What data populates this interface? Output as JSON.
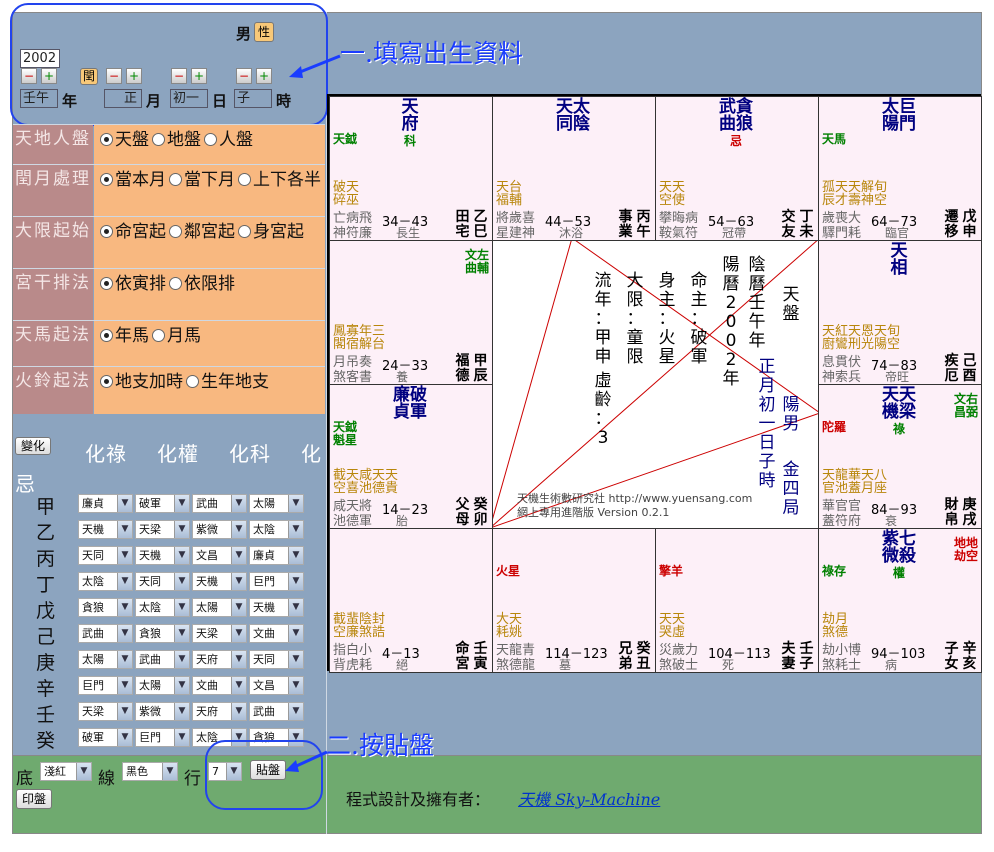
{
  "birth": {
    "gender_label": "男",
    "gender_button": "性",
    "year_input": "2002",
    "leap_button": "閏",
    "hour_box": "壬午",
    "year_label": "年",
    "month_box": "正",
    "month_label": "月",
    "day_box": "初一",
    "day_label": "日",
    "time_box": "子",
    "time_label": "時",
    "minus": "−",
    "plus": "+"
  },
  "annotations": {
    "step1": "一.填寫出生資料",
    "step2": "二.按貼盤"
  },
  "options": [
    {
      "label": "天地人盤",
      "choices": [
        "天盤",
        "地盤",
        "人盤"
      ],
      "selected": 0
    },
    {
      "label": "閏月處理",
      "choices": [
        "當本月",
        "當下月",
        "上下各半"
      ],
      "selected": 0
    },
    {
      "label": "大限起始",
      "choices": [
        "命宮起",
        "鄰宮起",
        "身宮起"
      ],
      "selected": 0
    },
    {
      "label": "宮干排法",
      "choices": [
        "依寅排",
        "依限排"
      ],
      "selected": 0
    },
    {
      "label": "天馬起法",
      "choices": [
        "年馬",
        "月馬"
      ],
      "selected": 0
    },
    {
      "label": "火鈴起法",
      "choices": [
        "地支加時",
        "生年地支"
      ],
      "selected": 0
    }
  ],
  "hua": {
    "button": "變化",
    "headers": [
      "化祿",
      "化權",
      "化科",
      "化忌"
    ],
    "rows": [
      {
        "stem": "甲",
        "v": [
          "廉貞",
          "破軍",
          "武曲",
          "太陽"
        ]
      },
      {
        "stem": "乙",
        "v": [
          "天機",
          "天梁",
          "紫微",
          "太陰"
        ]
      },
      {
        "stem": "丙",
        "v": [
          "天同",
          "天機",
          "文昌",
          "廉貞"
        ]
      },
      {
        "stem": "丁",
        "v": [
          "太陰",
          "天同",
          "天機",
          "巨門"
        ]
      },
      {
        "stem": "戊",
        "v": [
          "貪狼",
          "太陰",
          "太陽",
          "天機"
        ]
      },
      {
        "stem": "己",
        "v": [
          "武曲",
          "貪狼",
          "天梁",
          "文曲"
        ]
      },
      {
        "stem": "庚",
        "v": [
          "太陽",
          "武曲",
          "天府",
          "天同"
        ]
      },
      {
        "stem": "辛",
        "v": [
          "巨門",
          "太陽",
          "文曲",
          "文昌"
        ]
      },
      {
        "stem": "壬",
        "v": [
          "天梁",
          "紫微",
          "天府",
          "武曲"
        ]
      },
      {
        "stem": "癸",
        "v": [
          "破軍",
          "巨門",
          "太陰",
          "貪狼"
        ]
      }
    ]
  },
  "bottom": {
    "bg_label": "底",
    "bg_value": "淺紅",
    "line_label": "線",
    "line_value": "黑色",
    "row_label": "行",
    "row_value": "7",
    "paste_button": "貼盤",
    "print_button": "印盤",
    "credit_text": "程式設計及擁有者：",
    "credit_link": "天機 Sky-Machine"
  },
  "center": {
    "yin": "陰曆壬午年",
    "yang": "陽曆2002年",
    "month": "正月初一日子時",
    "pan": "天盤",
    "gender": "陽男",
    "ju": "金四局",
    "ming": "命主：破軍",
    "shen": "身主：火星",
    "daxian": "大限：童限",
    "liunian": "流年：甲申",
    "xusui": "虛齡：3",
    "footer1": "天機生術數研究社 http://www.yuensang.com",
    "footer2": "網上專用進階版 Version 0.2.1"
  },
  "palaces": [
    {
      "id": "si",
      "stars": [
        "天府"
      ],
      "mut": "科",
      "side_l": [
        "天鉞"
      ],
      "minor": [
        "破天",
        "碎巫"
      ],
      "line3": "亡病飛",
      "range": "34－43",
      "pal": "田宅",
      "stem": "乙巳",
      "line4": "神符廉",
      "life": "長生"
    },
    {
      "id": "wu",
      "stars": [
        "天同",
        "太陰"
      ],
      "mut": "",
      "side_l": [],
      "minor": [
        "天台",
        "福輔"
      ],
      "line3": "將歲喜",
      "range": "44－53",
      "pal": "事業",
      "stem": "丙午",
      "line4": "星建神",
      "life": "沐浴"
    },
    {
      "id": "wei",
      "stars": [
        "武曲",
        "貪狼"
      ],
      "mut": "忌",
      "side_l": [],
      "minor": [
        "天天",
        "空使"
      ],
      "line3": "攀晦病",
      "range": "54－63",
      "pal": "交友",
      "stem": "丁未",
      "line4": "鞍氣符",
      "life": "冠帶"
    },
    {
      "id": "shen",
      "stars": [
        "太陽",
        "巨門"
      ],
      "mut": "",
      "side_l": [
        "天馬"
      ],
      "minor": [
        "孤天天解旬",
        "辰才壽神空"
      ],
      "line3": "歲喪大",
      "range": "64－73",
      "pal": "遷移",
      "stem": "戊申",
      "line4": "驛門耗",
      "life": "臨官"
    },
    {
      "id": "chen",
      "stars": [],
      "mut": "",
      "side_r": [
        "文左",
        "曲輔"
      ],
      "minor": [
        "鳳寡年三",
        "閣宿解台"
      ],
      "line3": "月吊奏",
      "range": "24－33",
      "pal": "福德",
      "stem": "甲辰",
      "line4": "煞客書",
      "life": "養"
    },
    {
      "id": "you",
      "stars": [
        "天相"
      ],
      "mut": "",
      "minor": [
        "天紅天恩天旬",
        "廚鸞刑光陽空"
      ],
      "line3": "息貫伏",
      "range": "74－83",
      "pal": "疾厄",
      "stem": "己酉",
      "line4": "神索兵",
      "life": "帝旺"
    },
    {
      "id": "mao",
      "stars": [
        "廉貞",
        "破軍"
      ],
      "mut": "",
      "side_l": [
        "天鉞",
        "魁星"
      ],
      "minor": [
        "截天咸天天",
        "空喜池德貴"
      ],
      "line3": "咸天將",
      "range": "14－23",
      "pal": "父母",
      "stem": "癸卯",
      "line4": "池德軍",
      "life": "胎"
    },
    {
      "id": "xu",
      "stars": [
        "天機",
        "天梁"
      ],
      "mut": "祿",
      "side_l": [
        "陀羅"
      ],
      "side_r": [
        "文右",
        "昌弼"
      ],
      "minor": [
        "天龍華天八",
        "官池蓋月座"
      ],
      "line3": "華官官",
      "range": "84－93",
      "pal": "財帛",
      "stem": "庚戌",
      "line4": "蓋符府",
      "life": "衰"
    },
    {
      "id": "yin",
      "stars": [],
      "mut": "",
      "minor": [
        "截蜚陰封",
        "空廉煞誥"
      ],
      "line3": "指白小",
      "range": "4－13",
      "pal": "命宮",
      "stem": "壬寅",
      "line4": "背虎耗",
      "life": "絕"
    },
    {
      "id": "chou",
      "stars": [],
      "mut": "",
      "side_l": [
        "火星"
      ],
      "minor": [
        "大天",
        "耗姚"
      ],
      "line3": "天龍青",
      "range": "114－123",
      "pal": "兄弟",
      "stem": "癸丑",
      "line4": "煞德龍",
      "life": "墓"
    },
    {
      "id": "zi",
      "stars": [],
      "mut": "",
      "side_l": [
        "擎羊"
      ],
      "minor": [
        "天天",
        "哭虛"
      ],
      "line3": "災歲力",
      "range": "104－113",
      "pal": "夫妻",
      "stem": "壬子",
      "line4": "煞破士",
      "life": "死"
    },
    {
      "id": "hai",
      "stars": [
        "紫微",
        "七殺"
      ],
      "mut": "權",
      "side_l": [
        "祿存"
      ],
      "side_r": [
        "地地",
        "劫空"
      ],
      "minor": [
        "劫月",
        "煞德"
      ],
      "line3": "劫小博",
      "range": "94－103",
      "pal": "子女",
      "stem": "辛亥",
      "line4": "煞耗士",
      "life": "病"
    }
  ]
}
